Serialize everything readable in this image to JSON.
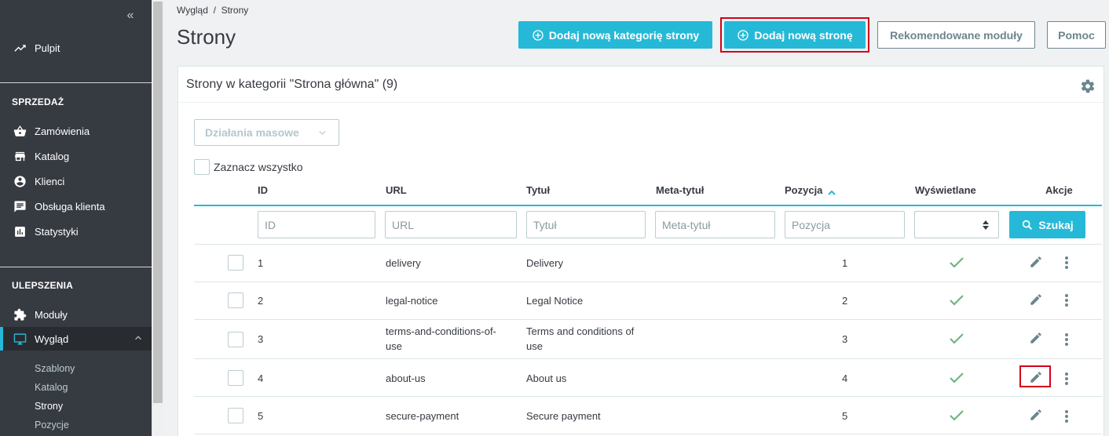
{
  "sidebar": {
    "dashboard": "Pulpit",
    "sales_title": "SPRZEDAŻ",
    "sales": [
      "Zamówienia",
      "Katalog",
      "Klienci",
      "Obsługa klienta",
      "Statystyki"
    ],
    "improve_title": "ULEPSZENIA",
    "modules": "Moduły",
    "design": "Wygląd",
    "design_sub": [
      "Szablony",
      "Katalog",
      "Strony",
      "Pozycje"
    ],
    "active_sub": "Strony"
  },
  "header": {
    "breadcrumb": "Wygląd  /  Strony",
    "title": "Strony",
    "btn_add_category": "Dodaj nową kategorię strony",
    "btn_add_page": "Dodaj nową stronę",
    "btn_modules": "Rekomendowane moduły",
    "btn_help": "Pomoc"
  },
  "panel": {
    "title": "Strony w kategorii \"Strona główna\" (9)",
    "bulk_actions": "Działania masowe",
    "select_all": "Zaznacz wszystko",
    "columns": {
      "id": "ID",
      "url": "URL",
      "title": "Tytuł",
      "meta_title": "Meta-tytuł",
      "position": "Pozycja",
      "displayed": "Wyświetlane",
      "actions": "Akcje"
    },
    "filters": {
      "id": "ID",
      "url": "URL",
      "title": "Tytuł",
      "meta_title": "Meta-tytuł",
      "position": "Pozycja"
    },
    "search": "Szukaj",
    "rows": [
      {
        "id": "1",
        "url": "delivery",
        "title": "Delivery",
        "meta": "",
        "position": "1"
      },
      {
        "id": "2",
        "url": "legal-notice",
        "title": "Legal Notice",
        "meta": "",
        "position": "2"
      },
      {
        "id": "3",
        "url": "terms-and-conditions-of-use",
        "title": "Terms and conditions of use",
        "meta": "",
        "position": "3"
      },
      {
        "id": "4",
        "url": "about-us",
        "title": "About us",
        "meta": "",
        "position": "4"
      },
      {
        "id": "5",
        "url": "secure-payment",
        "title": "Secure payment",
        "meta": "",
        "position": "5"
      }
    ]
  },
  "colors": {
    "accent": "#25b9d7",
    "sidebar": "#363a41",
    "ok": "#70b580",
    "highlight": "#d0021b"
  }
}
